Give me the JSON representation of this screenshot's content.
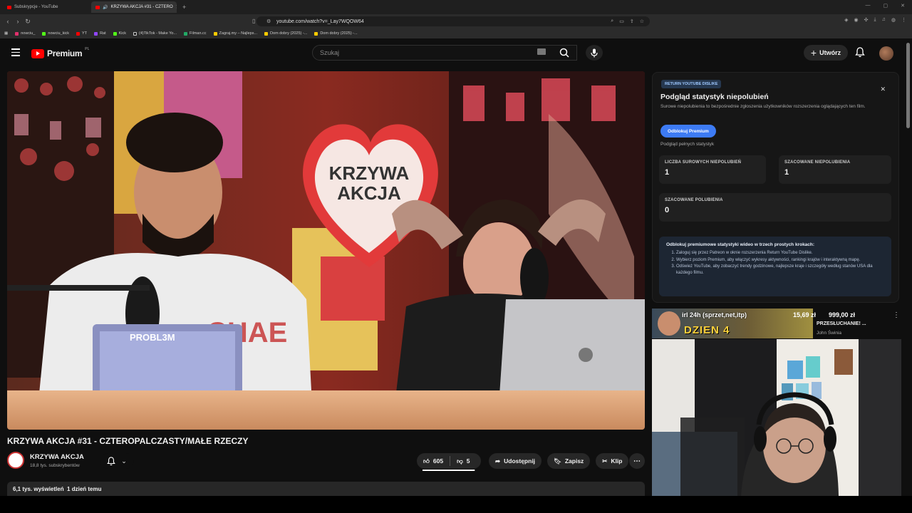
{
  "browser": {
    "tabs": [
      {
        "label": "Subskrypcje - YouTube",
        "active": false
      },
      {
        "label": "KRZYWA AKCJA #31 - CZTERO",
        "active": true
      }
    ],
    "new_tab": "+",
    "url": "youtube.com/watch?v=_Lay7WQOW64",
    "bookmarks": [
      "nowciu_",
      "nowciu_kick",
      "YT",
      "Rat",
      "Kick",
      "(4)TikTok - Make Yo...",
      "Filman.cc",
      "Zagraj.my – Najleps...",
      "Dom dobry (2025) -...",
      "Dom dobry (2025) -..."
    ]
  },
  "header": {
    "logo_text": "Premium",
    "logo_region": "PL",
    "search_placeholder": "Szukaj",
    "create_label": "Utwórz"
  },
  "video": {
    "title": "KRZYWA AKCJA #31 - CZTEROPALCZASTY/MAŁE RZECZY",
    "heart_text_line1": "KRZYWA",
    "heart_text_line2": "AKCJA",
    "laptop_sticker": "PROBL3M"
  },
  "channel": {
    "name": "KRZYWA AKCJA",
    "subscribers": "18,8 tys. subskrybentów"
  },
  "actions": {
    "likes": "605",
    "dislikes": "5",
    "like_ratio": 0.99,
    "share": "Udostępnij",
    "save": "Zapisz",
    "clip": "Klip"
  },
  "description": {
    "views": "6,1 tys. wyświetleń",
    "date": "1 dzień temu"
  },
  "dislike_panel": {
    "badge": "RETURN YOUTUBE DISLIKE",
    "title": "Podgląd statystyk niepolubień",
    "description": "Surowe niepolubienia to bezpośrednie zgłoszenia użytkowników rozszerzenia oglądających ten film.",
    "unlock_button": "Odblokuj Premium",
    "note": "Podgląd pełnych statystyk",
    "stats": [
      {
        "label": "LICZBA SUROWYCH NIEPOLUBIEŃ",
        "value": "1"
      },
      {
        "label": "SZACOWANE NIEPOLUBIENIA",
        "value": "1"
      },
      {
        "label": "SZACOWANE POLUBIENIA",
        "value": "0"
      }
    ],
    "steps_title": "Odblokuj premiumowe statystyki wideo w trzech prostych krokach:",
    "steps": [
      "Zaloguj się przez Patreon w oknie rozszerzenia Return YouTube Dislike.",
      "Wybierz poziom Premium, aby włączyć wykresy aktywności, rankingi krajów i interaktywną mapę.",
      "Odśwież YouTube, aby zobaczyć trendy godzinowe, najlepsze kraje i szczegóły według stanów USA dla każdego filmu."
    ]
  },
  "recommendation": {
    "overlay_text": "irl 24h (sprzet,net,itp)",
    "price1": "15,69 zł",
    "price2": "999,00 zł",
    "subtitle": "PRZESŁUCHANIE! ...",
    "author": "John Świnia",
    "thumb_text": "DZIEN 4"
  },
  "colors": {
    "accent_red": "#ff0000",
    "unlock_blue": "#3d7bf4",
    "panel_bg": "#161616"
  }
}
